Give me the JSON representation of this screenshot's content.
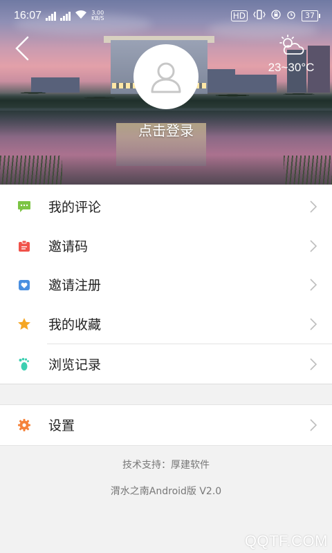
{
  "status_bar": {
    "time": "16:07",
    "speed_value": "3.00",
    "speed_unit": "KB/S",
    "hd_label": "HD",
    "battery": "37"
  },
  "header": {
    "back_icon": "chevron-left-icon",
    "weather_icon": "partly-cloudy-icon",
    "temperature": "23~30°C",
    "avatar_icon": "user-icon",
    "login_label": "点击登录"
  },
  "menu": {
    "items": [
      {
        "label": "我的评论",
        "icon": "comment-icon",
        "color": "#7cc444"
      },
      {
        "label": "邀请码",
        "icon": "badge-icon",
        "color": "#f0524a"
      },
      {
        "label": "邀请注册",
        "icon": "heart-card-icon",
        "color": "#4a8fe0"
      },
      {
        "label": "我的收藏",
        "icon": "star-icon",
        "color": "#f5a623"
      },
      {
        "label": "浏览记录",
        "icon": "footprint-icon",
        "color": "#3ccfb1"
      }
    ],
    "settings": {
      "label": "设置",
      "icon": "gear-icon",
      "color": "#f5823a"
    }
  },
  "footer": {
    "support": "技术支持：厚建软件",
    "version": "渭水之南Android版 V2.0"
  },
  "watermark": "QQTF.COM"
}
